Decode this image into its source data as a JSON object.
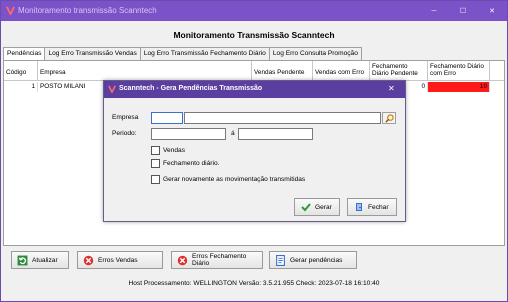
{
  "window": {
    "title": "Monitoramento transmissão Scanntech",
    "min_glyph": "─",
    "max_glyph": "☐",
    "close_glyph": "✕"
  },
  "header": {
    "title": "Monitoramento Transmissão Scanntech"
  },
  "tabs": [
    {
      "label": "Pendências",
      "active": true
    },
    {
      "label": "Log Erro Transmissão Vendas"
    },
    {
      "label": "Log Erro Transmissão Fechamento Diário"
    },
    {
      "label": "Log Erro Consulta Promoção"
    }
  ],
  "grid": {
    "columns": [
      "Código",
      "Empresa",
      "Vendas Pendente",
      "Vendas com Erro",
      "Fechamento Diário Pendente",
      "Fechamento Diário com Erro"
    ],
    "rows": [
      {
        "codigo": "1",
        "empresa": "POSTO MILANI",
        "vendas_pendente": "",
        "vendas_erro": "",
        "fech_pendente": "0",
        "fech_erro": "10"
      }
    ],
    "error_color": "#ff1a1a"
  },
  "dialog": {
    "title": "Scanntech - Gera Pendências Transmissão",
    "close_glyph": "✕",
    "empresa_label": "Empresa",
    "periodo_label": "Periodo:",
    "periodo_sep": "á",
    "empresa_code_value": "",
    "empresa_name_value": "",
    "periodo_inicio_value": "",
    "periodo_fim_value": "",
    "check_vendas": "Vendas",
    "check_fechamento": "Fechamento diário.",
    "check_gerar_novamente": "Gerar novamente as movimentação transmitidas",
    "gerar_button": "Gerar",
    "fechar_button": "Fechar"
  },
  "buttons": {
    "atualizar": "Atualizar",
    "erros_vendas": "Erros Vendas",
    "erros_fechamento": "Erros Fechamento Diário",
    "gerar_pendencias": "Gerar pendências"
  },
  "status": {
    "text": "Host Processamento: WELLINGTON Versão: 3.5.21.955 Check: 2023-07-18 16:10:40"
  },
  "colors": {
    "titlebar": "#7b52c7",
    "dialog_titlebar": "#5b3fa0",
    "accent": "#ff1a1a"
  },
  "icons": {
    "app": "scanntech-logo-icon",
    "search": "search-icon",
    "gerar": "check-icon",
    "fechar": "door-exit-icon",
    "atualizar": "refresh-icon",
    "erros": "error-icon",
    "gerar_pendencias": "document-icon"
  }
}
